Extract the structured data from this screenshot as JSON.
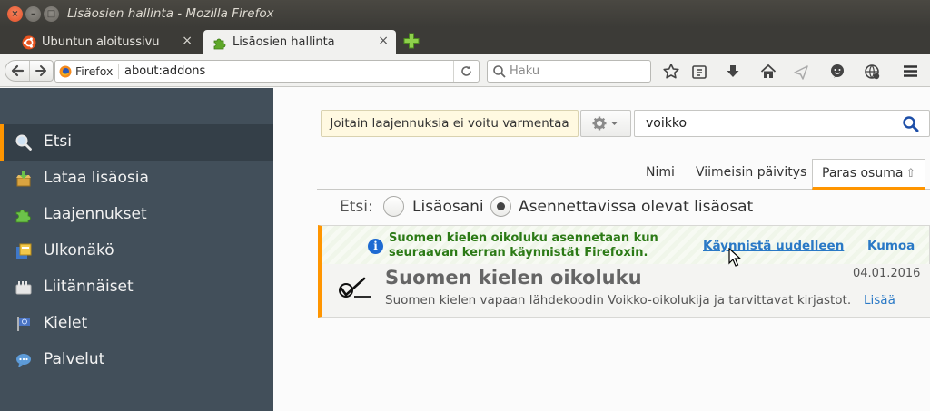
{
  "window": {
    "title": "Lisäosien hallinta - Mozilla Firefox",
    "close_glyph": "×",
    "minimize_glyph": "–",
    "maximize_glyph": "□"
  },
  "tabs": [
    {
      "label": "Ubuntun aloitussivu",
      "icon": "ubuntu-icon",
      "active": false,
      "close_glyph": "×"
    },
    {
      "label": "Lisäosien hallinta",
      "icon": "puzzle-icon",
      "active": true,
      "close_glyph": "×"
    }
  ],
  "toolbar": {
    "identity_label": "Firefox",
    "url": "about:addons",
    "search_placeholder": "Haku"
  },
  "sidebar": {
    "items": [
      {
        "label": "Etsi",
        "icon": "search-icon",
        "selected": true
      },
      {
        "label": "Lataa lisäosia",
        "icon": "download-box-icon",
        "selected": false
      },
      {
        "label": "Laajennukset",
        "icon": "puzzle-icon",
        "selected": false
      },
      {
        "label": "Ulkonäkö",
        "icon": "appearance-icon",
        "selected": false
      },
      {
        "label": "Liitännäiset",
        "icon": "plugin-icon",
        "selected": false
      },
      {
        "label": "Kielet",
        "icon": "language-flag-icon",
        "selected": false
      },
      {
        "label": "Palvelut",
        "icon": "services-chat-icon",
        "selected": false
      }
    ]
  },
  "main": {
    "warning_button": "Joitain laajennuksia ei voitu varmentaa",
    "search_value": "voikko",
    "sort": {
      "name": "Nimi",
      "last_updated": "Viimeisin päivitys",
      "best_match": "Paras osuma",
      "arrow": "⇧"
    },
    "scope": {
      "label": "Etsi:",
      "my_addons": "Lisäosani",
      "available": "Asennettavissa olevat lisäosat",
      "selected": "available"
    },
    "addon": {
      "notice": "Suomen kielen oikoluku asennetaan kun seuraavan kerran käynnistät Firefoxin.",
      "restart_label": "Käynnistä uudelleen",
      "undo_label": "Kumoa",
      "name": "Suomen kielen oikoluku",
      "date": "04.01.2016",
      "description": "Suomen kielen vapaan lähdekoodin Voikko-oikolukija ja tarvittavat kirjastot.",
      "more_label": "Lisää"
    }
  },
  "colors": {
    "accent": "#ff9500",
    "sidebar_bg": "#424f5a",
    "sidebar_selected": "#343f48",
    "link": "#2a79c6",
    "notice_green": "#2c7a16"
  }
}
